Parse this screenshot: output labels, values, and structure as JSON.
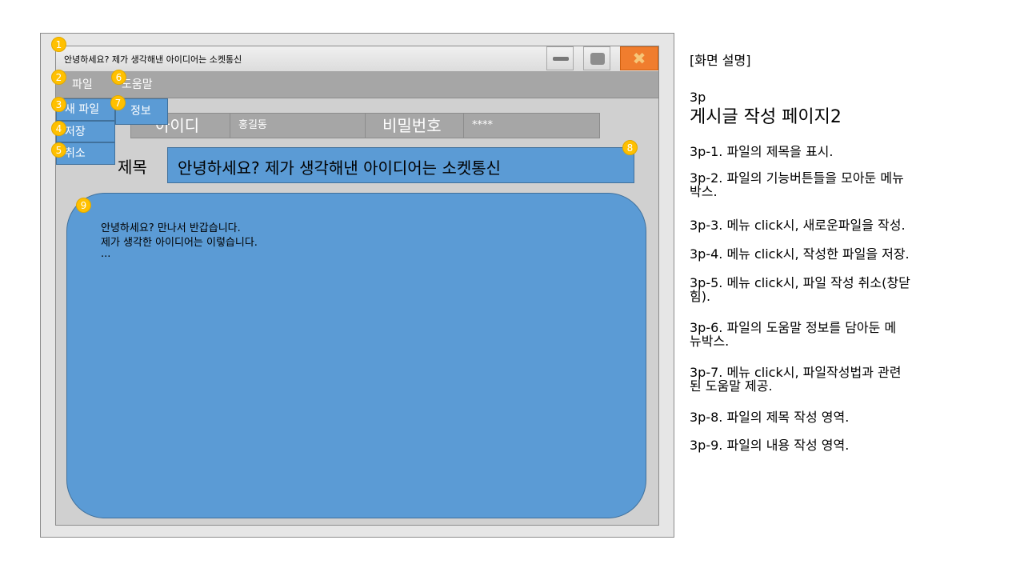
{
  "window": {
    "title": "안녕하세요? 제가 생각해낸 아이디어는 소켓통신",
    "close_glyph": "✖"
  },
  "menu": {
    "file": "파일",
    "help": "도움말",
    "file_items": [
      "새 파일",
      "저장",
      "취소"
    ],
    "help_items": [
      "정보"
    ]
  },
  "user_row": {
    "id_label": "아이디",
    "id_value": "홍길동",
    "password_label": "비밀번호",
    "password_value": "****"
  },
  "post": {
    "title_label": "제목",
    "title_value": "안녕하세요? 제가 생각해낸 아이디어는 소켓통신",
    "content_lines": [
      "안녕하세요? 만나서 반갑습니다.",
      "제가 생각한 아이디어는 이렇습니다.",
      "..."
    ]
  },
  "badges": [
    "1",
    "2",
    "3",
    "4",
    "5",
    "6",
    "7",
    "8",
    "9"
  ],
  "description": {
    "header": "[화면 설명]",
    "page_code": "3p",
    "page_name": "게시글 작성 페이지2",
    "items": [
      [
        "3p-1. 파일의 제목을 표시."
      ],
      [
        "3p-2. 파일의 기능버튼들을 모아둔 메뉴",
        "박스."
      ],
      [
        "3p-3. 메뉴 click시, 새로운파일을 작성."
      ],
      [
        "3p-4. 메뉴 click시, 작성한 파일을 저장."
      ],
      [
        "3p-5. 메뉴 click시, 파일 작성 취소(창닫",
        "힘)."
      ],
      [
        "3p-6. 파일의 도움말 정보를 담아둔 메",
        "뉴박스."
      ],
      [
        "3p-7. 메뉴 click시, 파일작성법과 관련",
        "된 도움말 제공."
      ],
      [
        "3p-8. 파일의 제목 작성 영역."
      ],
      [
        "3p-9. 파일의 내용 작성 영역."
      ]
    ]
  },
  "colors": {
    "accent_blue": "#5b9bd5",
    "badge_yellow": "#ffc000",
    "close_orange": "#f07d2e",
    "menubar_gray": "#a6a6a6"
  }
}
